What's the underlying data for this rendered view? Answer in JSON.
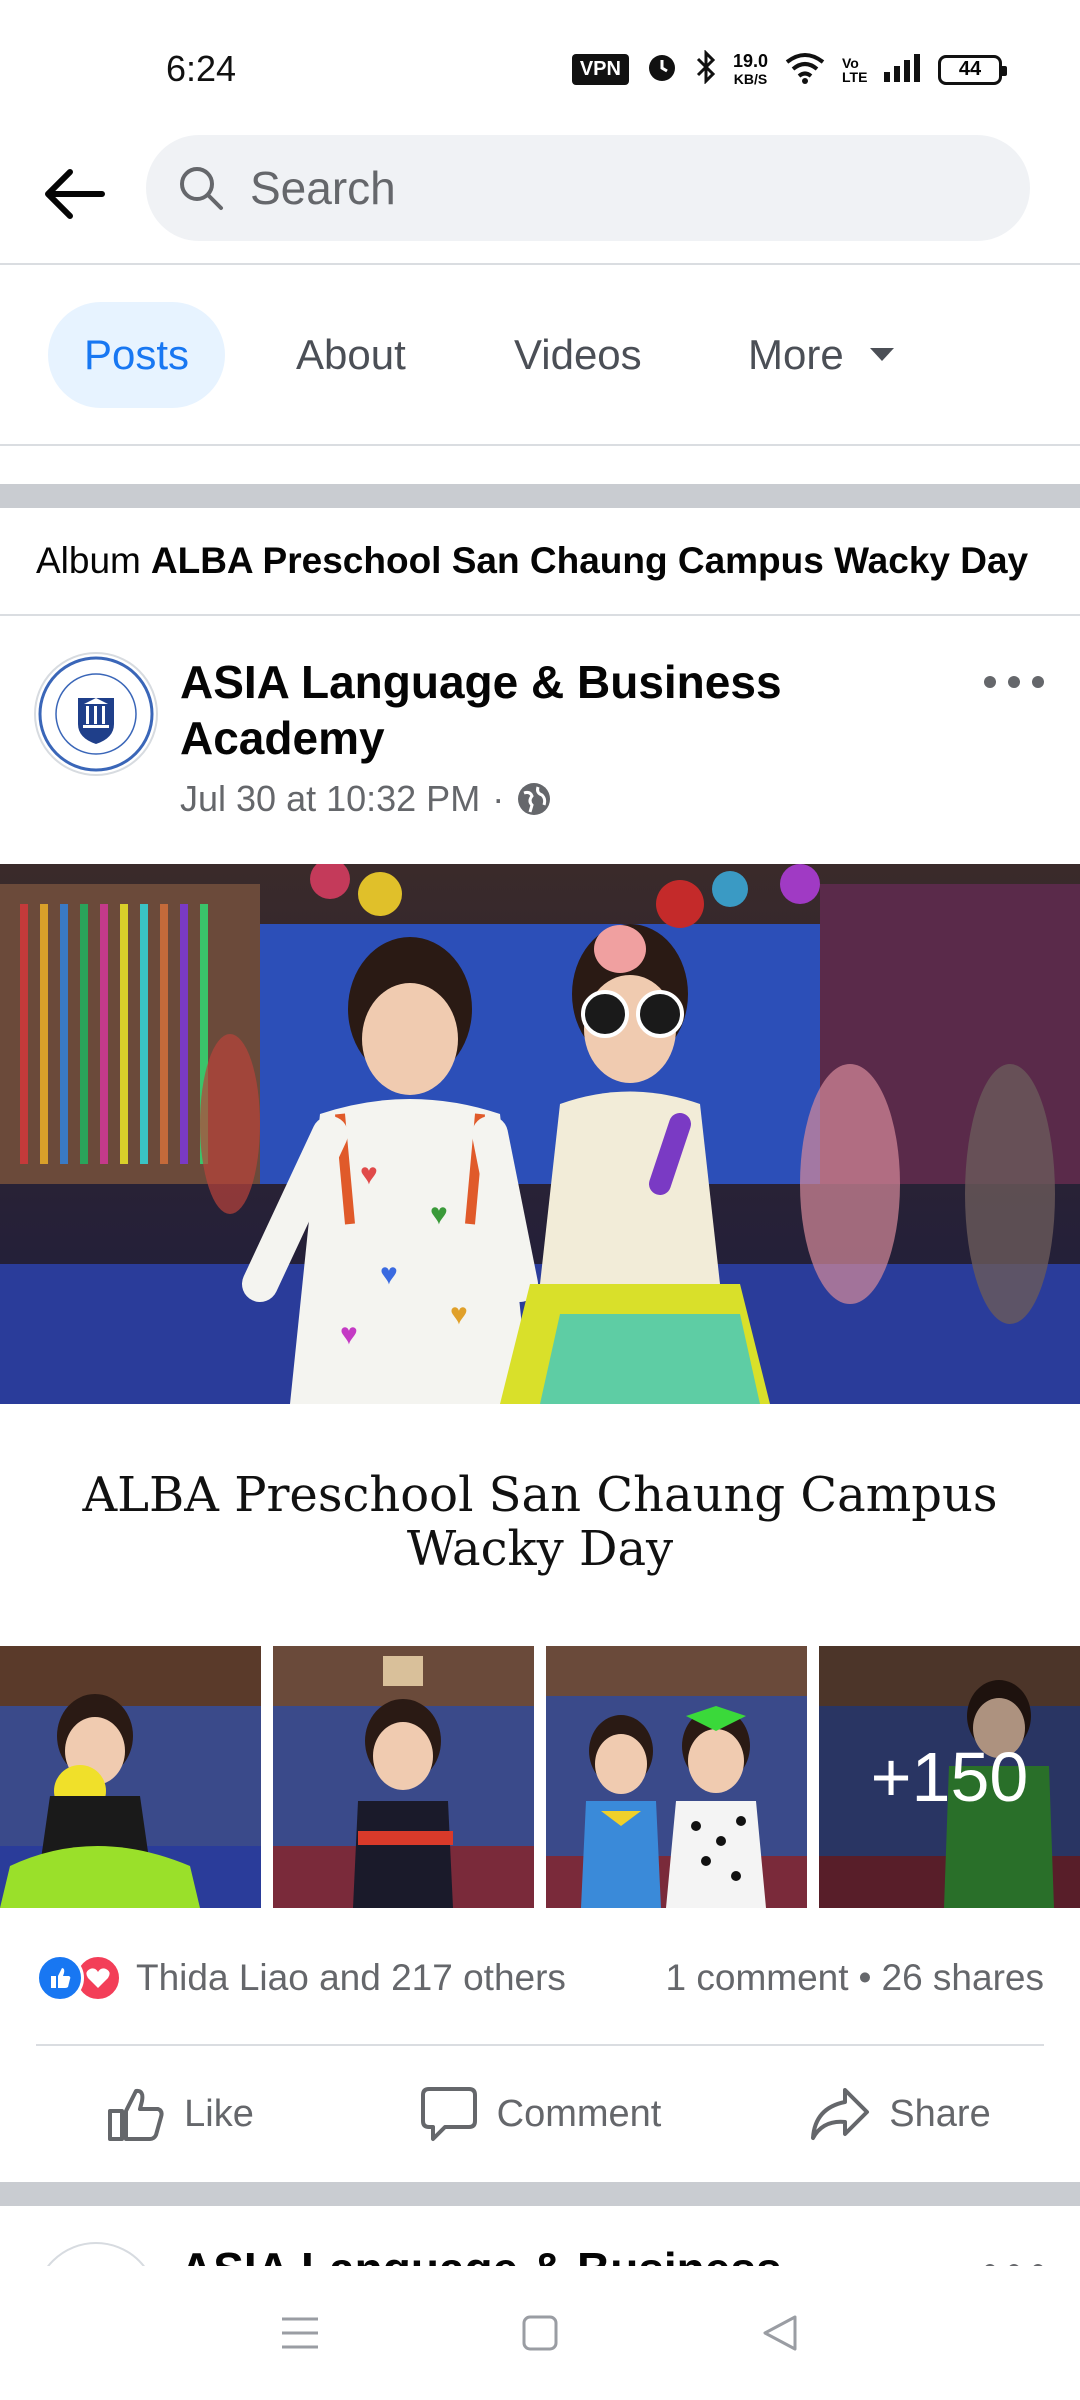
{
  "status_bar": {
    "time": "6:24",
    "vpn": "VPN",
    "speed_value": "19.0",
    "speed_unit": "KB/S",
    "volte": "Vo LTE",
    "battery": "44"
  },
  "search": {
    "placeholder": "Search"
  },
  "tabs": [
    {
      "label": "Posts",
      "active": true
    },
    {
      "label": "About",
      "active": false
    },
    {
      "label": "Videos",
      "active": false
    },
    {
      "label": "More",
      "active": false
    }
  ],
  "album_line": {
    "prefix": "Album",
    "name": "ALBA Preschool San Chaung Campus Wacky Day"
  },
  "post": {
    "page_name": "ASIA Language & Business Academy",
    "timestamp": "Jul 30 at 10:32 PM",
    "separator": "·",
    "album_title": "ALBA Preschool San Chaung Campus Wacky Day",
    "more_photos": "+150",
    "reactions_text": "Thida Liao and 217 others",
    "comments": "1 comment",
    "dot": "•",
    "shares": "26 shares",
    "actions": {
      "like": "Like",
      "comment": "Comment",
      "share": "Share"
    }
  },
  "next_post": {
    "page_name": "ASIA Language & Business"
  },
  "colors": {
    "brand_blue": "#1877f2",
    "active_tab_bg": "#e7f3ff",
    "love_red": "#f33e58",
    "secondary_text": "#65676b"
  }
}
